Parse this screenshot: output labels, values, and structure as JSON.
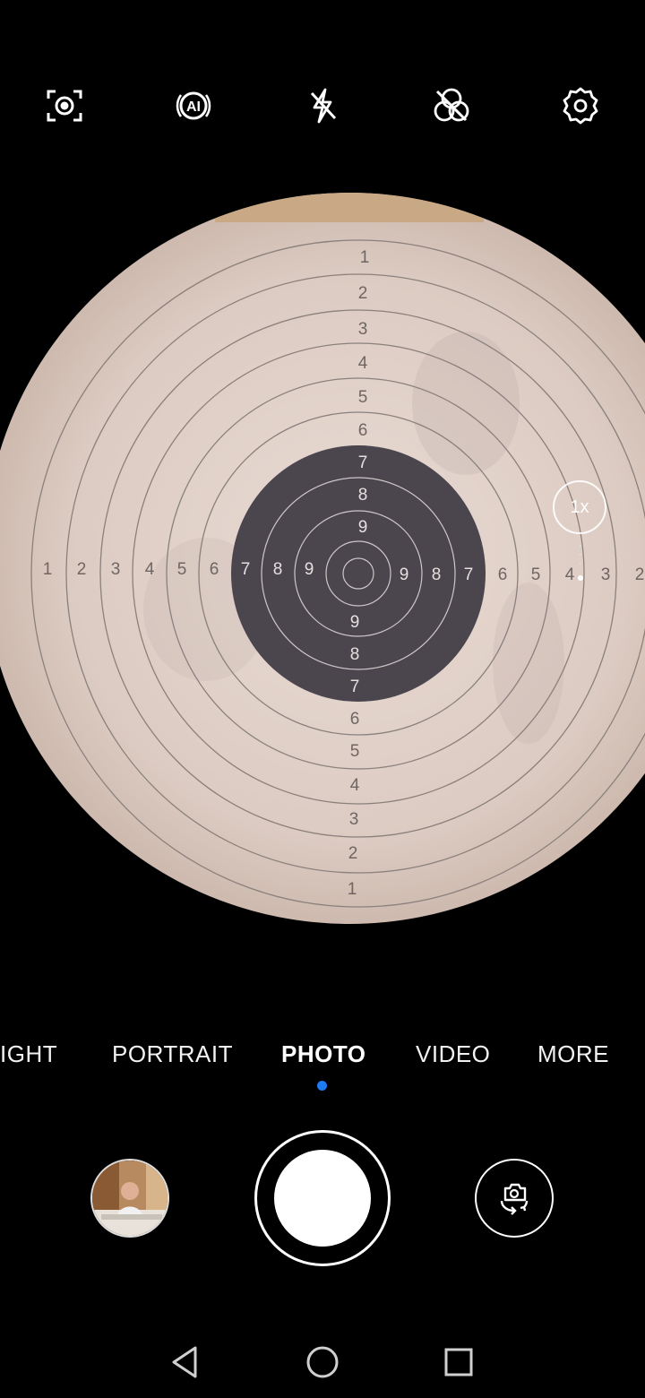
{
  "top_bar": {
    "icons": [
      "focus-detection-icon",
      "ai-scene-icon",
      "flash-off-icon",
      "live-photo-off-icon",
      "gear-icon"
    ]
  },
  "viewfinder": {
    "zoom_label": "1x",
    "target_labels": {
      "vertical_top": [
        "1",
        "2",
        "3",
        "4",
        "5",
        "6",
        "7",
        "8",
        "9"
      ],
      "vertical_bottom": [
        "9",
        "8",
        "7",
        "6",
        "5",
        "4",
        "3",
        "2",
        "1"
      ],
      "horizontal_left": [
        "1",
        "2",
        "3",
        "4",
        "5",
        "6",
        "7",
        "8",
        "9"
      ],
      "horizontal_right": [
        "9",
        "8",
        "7",
        "6",
        "5",
        "4",
        "3",
        "2"
      ]
    }
  },
  "modes": {
    "items": [
      "IGHT",
      "PORTRAIT",
      "PHOTO",
      "VIDEO",
      "MORE"
    ],
    "active": "PHOTO"
  },
  "controls": {
    "gallery_icon": "gallery-thumbnail",
    "shutter_icon": "shutter-button",
    "switch_icon": "camera-switch-icon"
  },
  "navigation": {
    "icons": [
      "back-icon",
      "home-icon",
      "recents-icon"
    ]
  },
  "colors": {
    "accent": "#1e7cf2",
    "target_paper": "#e3d3cb",
    "target_bull": "#4a444d"
  }
}
